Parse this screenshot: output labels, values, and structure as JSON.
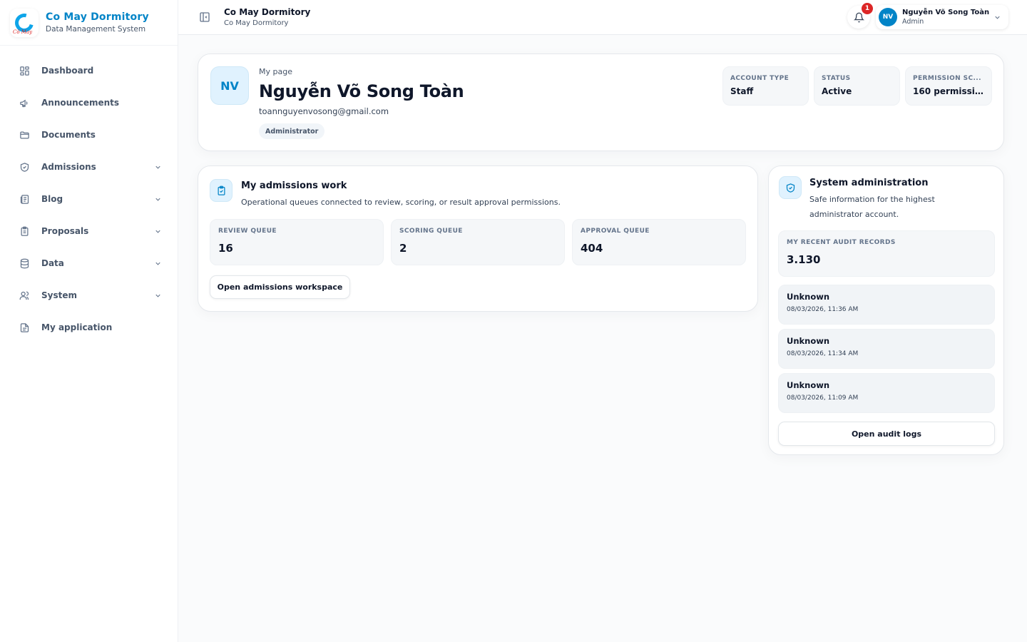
{
  "brand": {
    "title": "Co May Dormitory",
    "subtitle": "Data Management System",
    "logo_script": "Cô May"
  },
  "sidebar": {
    "items": [
      {
        "label": "Dashboard",
        "icon": "grid-icon",
        "has_children": false
      },
      {
        "label": "Announcements",
        "icon": "megaphone-icon",
        "has_children": false
      },
      {
        "label": "Documents",
        "icon": "folder-icon",
        "has_children": false
      },
      {
        "label": "Admissions",
        "icon": "shield-icon",
        "has_children": true
      },
      {
        "label": "Blog",
        "icon": "newspaper-icon",
        "has_children": true
      },
      {
        "label": "Proposals",
        "icon": "clipboard-icon",
        "has_children": true
      },
      {
        "label": "Data",
        "icon": "database-icon",
        "has_children": true
      },
      {
        "label": "System",
        "icon": "users-icon",
        "has_children": true
      },
      {
        "label": "My application",
        "icon": "file-text-icon",
        "has_children": false
      }
    ]
  },
  "header": {
    "title": "Co May Dormitory",
    "subtitle": "Co May Dormitory",
    "notification_count": "1",
    "user": {
      "initials": "NV",
      "name": "Nguyễn Võ Song Toàn",
      "role": "Admin"
    }
  },
  "profile": {
    "initials": "NV",
    "eyebrow": "My page",
    "name": "Nguyễn Võ Song Toàn",
    "email": "toannguyenvosong@gmail.com",
    "role_badge": "Administrator",
    "stats": [
      {
        "label": "ACCOUNT TYPE",
        "value": "Staff"
      },
      {
        "label": "STATUS",
        "value": "Active"
      },
      {
        "label": "PERMISSION SC...",
        "value": "160 permissio..."
      }
    ]
  },
  "admissions": {
    "title": "My admissions work",
    "description": "Operational queues connected to review, scoring, or result approval permissions.",
    "queues": [
      {
        "label": "REVIEW QUEUE",
        "value": "16"
      },
      {
        "label": "SCORING QUEUE",
        "value": "2"
      },
      {
        "label": "APPROVAL QUEUE",
        "value": "404"
      }
    ],
    "button_label": "Open admissions workspace"
  },
  "system_admin": {
    "title": "System administration",
    "description": "Safe information for the highest administrator account.",
    "audit_label": "MY RECENT AUDIT RECORDS",
    "audit_value": "3.130",
    "logs": [
      {
        "title": "Unknown",
        "time": "08/03/2026, 11:36 AM"
      },
      {
        "title": "Unknown",
        "time": "08/03/2026, 11:34 AM"
      },
      {
        "title": "Unknown",
        "time": "08/03/2026, 11:09 AM"
      }
    ],
    "button_label": "Open audit logs"
  },
  "colors": {
    "accent": "#0284c7",
    "accent_light": "#e0f2fe",
    "badge_red": "#dc2626",
    "text_primary": "#0f172a",
    "text_muted": "#475569"
  }
}
